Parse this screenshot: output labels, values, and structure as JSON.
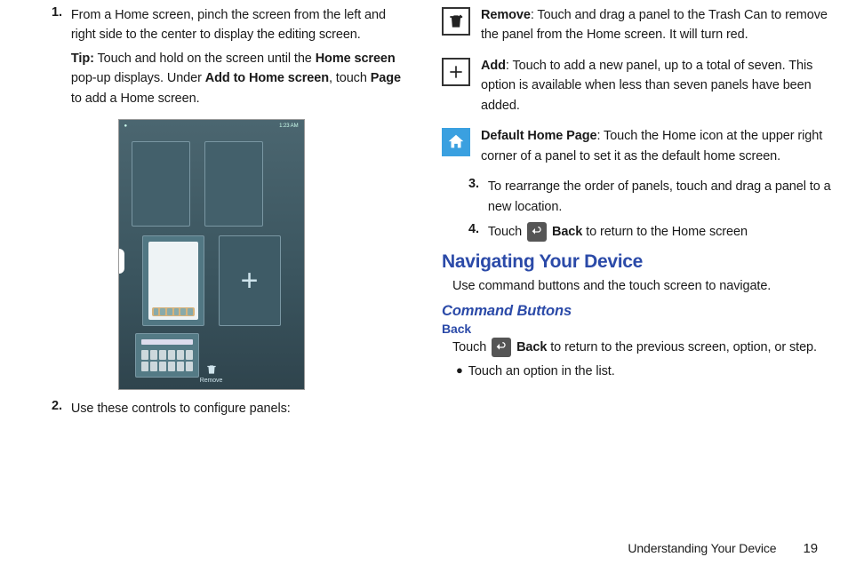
{
  "left": {
    "steps": {
      "s1": {
        "num": "1.",
        "text": "From a Home screen, pinch the screen from the left and right side to the center to display the editing screen.",
        "tip_label": "Tip:",
        "tip_pre": " Touch and hold on the screen until the ",
        "tip_bold1": "Home screen",
        "tip_mid": " pop-up displays. Under ",
        "tip_bold2": "Add to Home screen",
        "tip_mid2": ", touch ",
        "tip_bold3": "Page",
        "tip_end": " to add a Home screen."
      },
      "s2": {
        "num": "2.",
        "text": "Use these controls to configure panels:"
      }
    },
    "figure": {
      "status_left": "●",
      "status_right": "1:23 AM",
      "plus": "+",
      "trash_label": "Remove"
    }
  },
  "right": {
    "icons": {
      "remove": {
        "label": "Remove",
        "text": ": Touch and drag a panel to the Trash Can to remove the panel from the Home screen. It will turn red."
      },
      "add": {
        "label": "Add",
        "text": ": Touch to add a new panel, up to a total of seven. This option is available when less than seven panels have been added."
      },
      "home": {
        "label": "Default Home Page",
        "text": ": Touch the Home icon at the upper right corner of a panel to set it as the default home screen."
      }
    },
    "steps": {
      "s3": {
        "num": "3.",
        "text": "To rearrange the order of panels, touch and drag a panel to a new location."
      },
      "s4": {
        "num": "4.",
        "pre": "Touch ",
        "bold": "Back",
        "post": " to return to the Home screen"
      }
    },
    "nav": {
      "heading": "Navigating Your Device",
      "intro": "Use command buttons and the touch screen to navigate.",
      "sub": "Command Buttons",
      "mini": "Back",
      "back_pre": "Touch ",
      "back_bold": "Back",
      "back_post": " to return to the previous screen, option, or step.",
      "bullet": "Touch an option in the list."
    }
  },
  "footer": {
    "section": "Understanding Your Device",
    "page": "19"
  }
}
